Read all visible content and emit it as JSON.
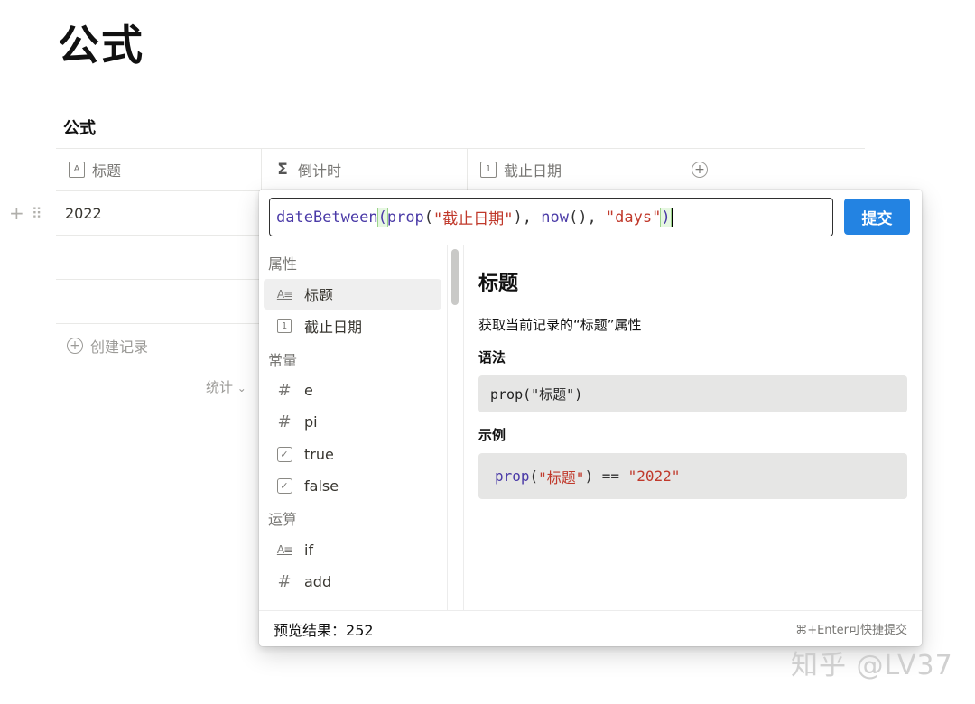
{
  "page": {
    "title": "公式",
    "database_title": "公式"
  },
  "table": {
    "columns": [
      {
        "label": "标题",
        "icon": "text-property-icon"
      },
      {
        "label": "倒计时",
        "icon": "sigma-formula-icon"
      },
      {
        "label": "截止日期",
        "icon": "calendar-icon"
      }
    ],
    "add_column_icon": "add-column-icon",
    "rows": [
      "2022",
      "",
      ""
    ],
    "new_record_label": "创建记录",
    "stats_label": "统计"
  },
  "formula_editor": {
    "tokens": [
      {
        "text": "dateBetween",
        "kind": "fn"
      },
      {
        "text": "(",
        "kind": "paren"
      },
      {
        "text": "prop",
        "kind": "fn"
      },
      {
        "text": "(",
        "kind": "plain"
      },
      {
        "text": "\"截止日期\"",
        "kind": "str"
      },
      {
        "text": "), ",
        "kind": "plain"
      },
      {
        "text": "now",
        "kind": "fn"
      },
      {
        "text": "(), ",
        "kind": "plain"
      },
      {
        "text": "\"days\"",
        "kind": "str"
      },
      {
        "text": ")",
        "kind": "paren"
      }
    ],
    "submit_label": "提交",
    "groups": [
      {
        "label": "属性",
        "items": [
          {
            "label": "标题",
            "icon": "text-property-icon",
            "selected": true
          },
          {
            "label": "截止日期",
            "icon": "calendar-icon",
            "selected": false
          }
        ]
      },
      {
        "label": "常量",
        "items": [
          {
            "label": "e",
            "icon": "number-hash-icon"
          },
          {
            "label": "pi",
            "icon": "number-hash-icon"
          },
          {
            "label": "true",
            "icon": "checkbox-icon"
          },
          {
            "label": "false",
            "icon": "checkbox-icon"
          }
        ]
      },
      {
        "label": "运算",
        "items": [
          {
            "label": "if",
            "icon": "text-property-icon"
          },
          {
            "label": "add",
            "icon": "number-hash-icon"
          }
        ]
      }
    ],
    "detail": {
      "title": "标题",
      "description": "获取当前记录的“标题”属性",
      "syntax_heading": "语法",
      "syntax_code": "prop(\"标题\")",
      "example_heading": "示例",
      "example_tokens": [
        {
          "text": "prop",
          "kind": "fn"
        },
        {
          "text": "(",
          "kind": "plain"
        },
        {
          "text": "\"标题\"",
          "kind": "str"
        },
        {
          "text": ") == ",
          "kind": "plain"
        },
        {
          "text": "\"2022\"",
          "kind": "str"
        }
      ]
    },
    "preview_label": "预览结果：",
    "preview_value": "252",
    "shortcut_hint": "⌘+Enter可快捷提交"
  },
  "watermark": "知乎 @LV37",
  "colors": {
    "accent": "#2383e2",
    "function": "#4a3aa7",
    "string": "#c0392b"
  }
}
